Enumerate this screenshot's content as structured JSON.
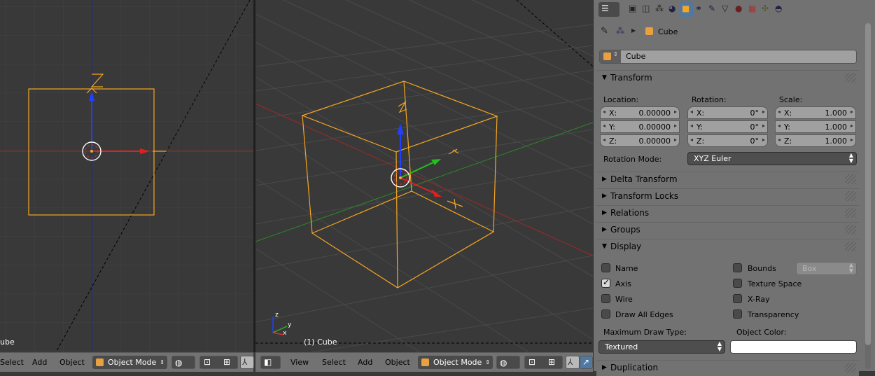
{
  "left_viewport": {
    "object_label": "ube",
    "header": {
      "select": "Select",
      "add": "Add",
      "object": "Object",
      "mode": "Object Mode"
    }
  },
  "main_viewport": {
    "object_label": "(1) Cube",
    "header": {
      "view": "View",
      "select": "Select",
      "add": "Add",
      "object": "Object",
      "mode": "Object Mode"
    }
  },
  "properties": {
    "breadcrumb": {
      "object": "Cube"
    },
    "object_name": "Cube",
    "transform": {
      "title": "Transform",
      "location_label": "Location:",
      "rotation_label": "Rotation:",
      "scale_label": "Scale:",
      "location": [
        {
          "axis": "X:",
          "value": "0.00000"
        },
        {
          "axis": "Y:",
          "value": "0.00000"
        },
        {
          "axis": "Z:",
          "value": "0.00000"
        }
      ],
      "rotation": [
        {
          "axis": "X:",
          "value": "0°"
        },
        {
          "axis": "Y:",
          "value": "0°"
        },
        {
          "axis": "Z:",
          "value": "0°"
        }
      ],
      "scale": [
        {
          "axis": "X:",
          "value": "1.000"
        },
        {
          "axis": "Y:",
          "value": "1.000"
        },
        {
          "axis": "Z:",
          "value": "1.000"
        }
      ],
      "rotation_mode_label": "Rotation Mode:",
      "rotation_mode": "XYZ Euler"
    },
    "panels": {
      "delta_transform": "Delta Transform",
      "transform_locks": "Transform Locks",
      "relations": "Relations",
      "groups": "Groups",
      "display": "Display",
      "duplication": "Duplication"
    },
    "display": {
      "name": "Name",
      "axis": "Axis",
      "wire": "Wire",
      "draw_all_edges": "Draw All Edges",
      "bounds": "Bounds",
      "bounds_type": "Box",
      "texture_space": "Texture Space",
      "xray": "X-Ray",
      "transparency": "Transparency",
      "max_draw_type_label": "Maximum Draw Type:",
      "max_draw_type": "Textured",
      "object_color_label": "Object Color:",
      "object_color": "#ffffff",
      "axis_checked": true
    }
  },
  "colors": {
    "selection": "#f5a623",
    "x_axis": "#c03030",
    "y_axis": "#40a040",
    "z_axis": "#2040e0",
    "active_tab": "#5078a0"
  }
}
